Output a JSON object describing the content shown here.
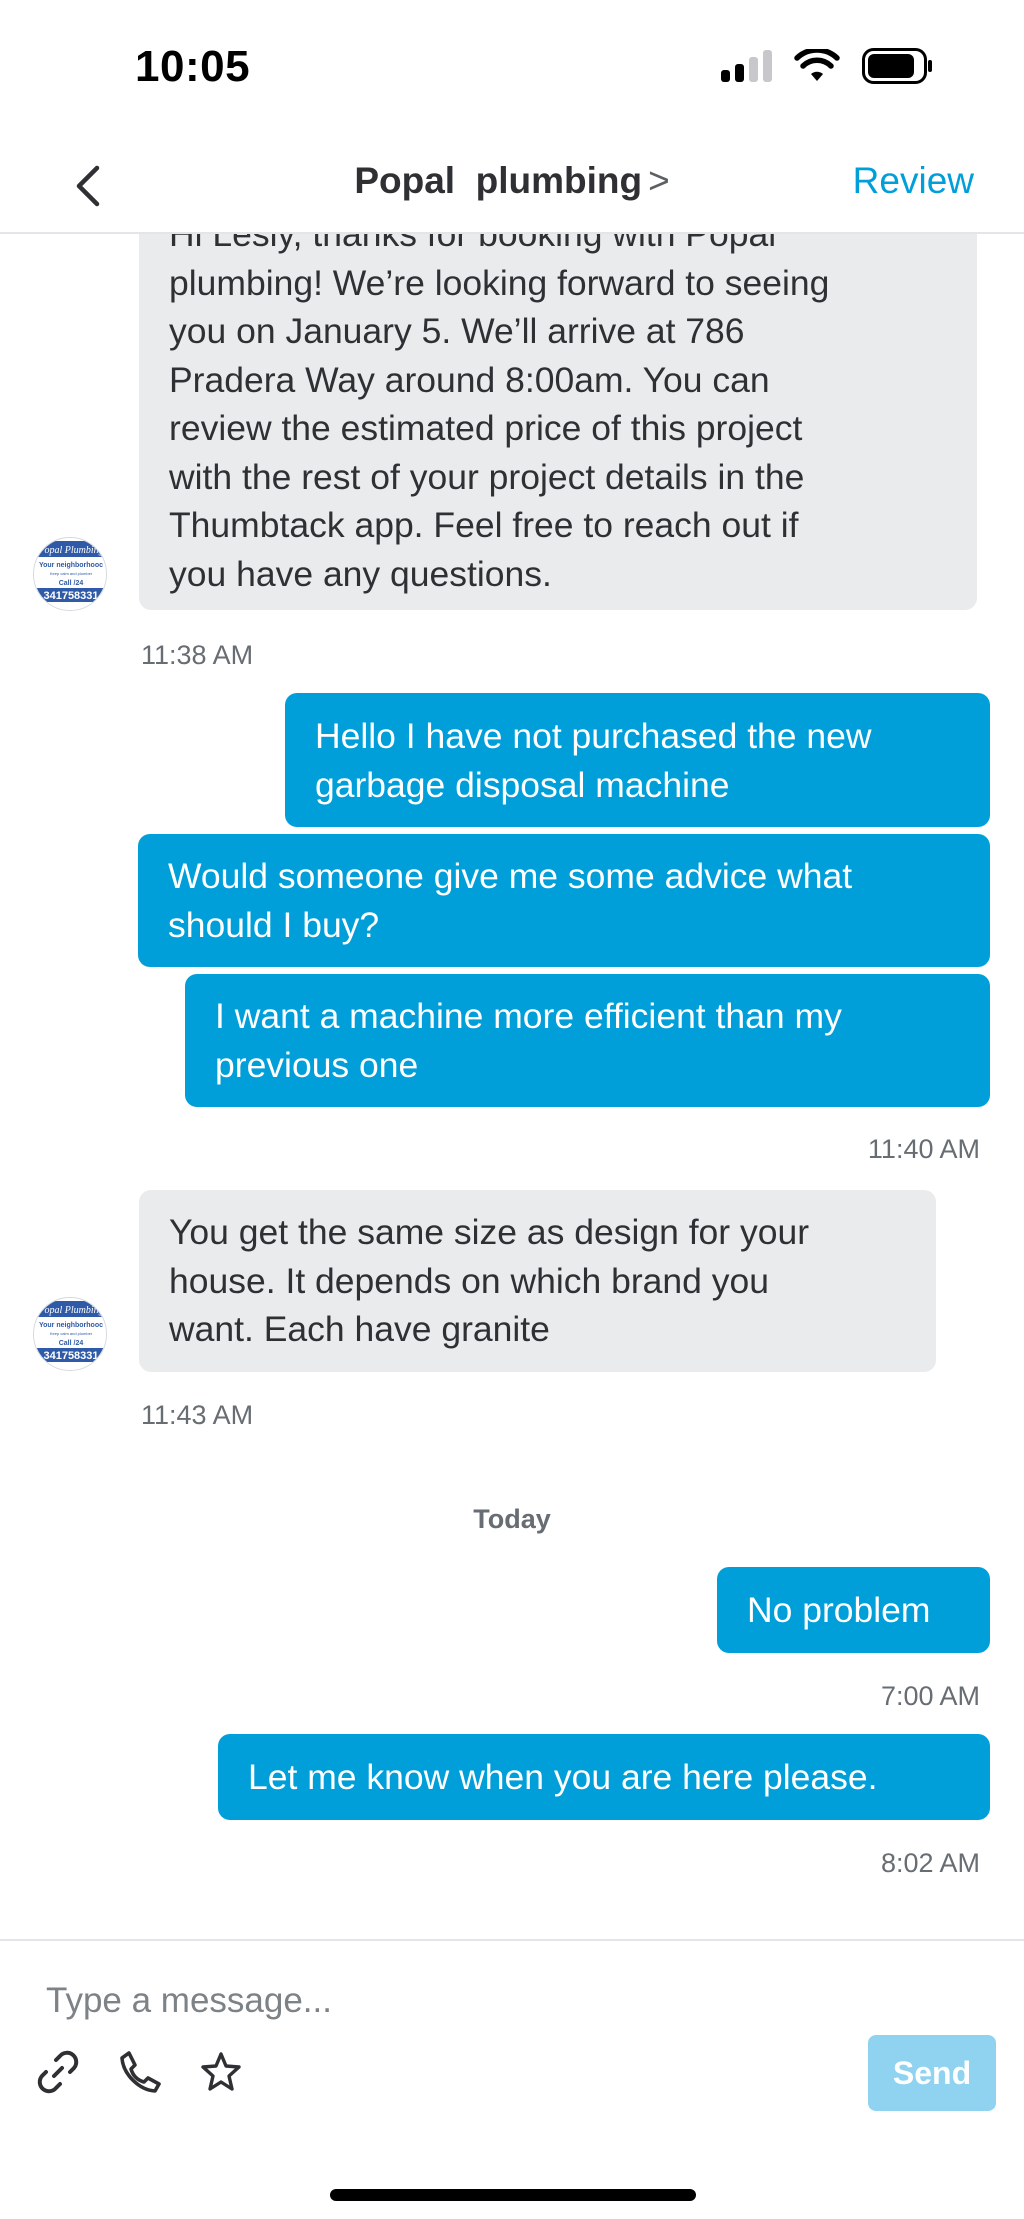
{
  "status_bar": {
    "time": "10:05"
  },
  "header": {
    "title": "Popal  plumbing",
    "title_chevron": ">",
    "review_label": "Review"
  },
  "avatar": {
    "line1": "Popal Plumbing",
    "line2": "Your neighborhooc",
    "line3": "Keep calm and plumber",
    "line4": "Call /24",
    "line5": "341758331"
  },
  "messages": [
    {
      "id": "m1",
      "direction": "in",
      "lines": [
        "Hi Lesly, thanks for booking with Popal",
        "plumbing! We’re looking forward to seeing",
        "you on January 5. We’ll arrive at 786",
        "Pradera Way around 8:00am. You can",
        "review the estimated price of this project",
        "with the rest of your project details in the",
        "Thumbtack app. Feel free to reach out if",
        "you have any questions."
      ],
      "time": "11:38 AM"
    },
    {
      "id": "m2",
      "direction": "out",
      "lines": [
        "Hello I have not purchased the new",
        "garbage disposal machine"
      ]
    },
    {
      "id": "m3",
      "direction": "out",
      "lines": [
        "Would someone give me some advice what",
        "should I buy?"
      ]
    },
    {
      "id": "m4",
      "direction": "out",
      "lines": [
        "I want a machine more efficient than my",
        "previous one"
      ],
      "time": "11:40 AM"
    },
    {
      "id": "m5",
      "direction": "in",
      "lines": [
        "You get the same size as design for your",
        "house. It depends on which brand you",
        "want. Each have granite"
      ],
      "time": "11:43 AM"
    },
    {
      "id": "m6",
      "direction": "out",
      "lines": [
        "No problem"
      ],
      "time": "7:00 AM"
    },
    {
      "id": "m7",
      "direction": "out",
      "lines": [
        "Let me know when you are here please."
      ],
      "time": "8:02 AM"
    }
  ],
  "day_separator": "Today",
  "composer": {
    "placeholder": "Type a message...",
    "send_label": "Send"
  },
  "colors": {
    "accent": "#009fd9",
    "incoming_bubble": "#e9ebed",
    "send_disabled": "#8fd3f0"
  },
  "icons": [
    "chevron-left-icon",
    "chevron-right-icon",
    "link-icon",
    "phone-icon",
    "star-icon",
    "signal-icon",
    "wifi-icon",
    "battery-icon"
  ]
}
